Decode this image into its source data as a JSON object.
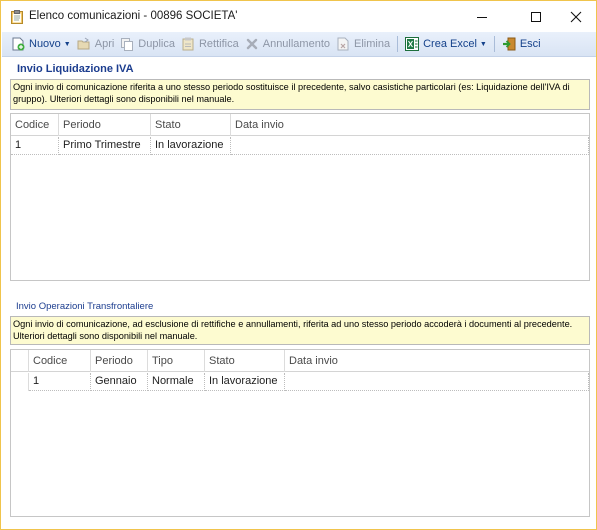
{
  "window": {
    "title": "Elenco comunicazioni - 00896 SOCIETA'",
    "icon": "clipboard-icon",
    "controls": {
      "minimize": "minimize-icon",
      "maximize": "maximize-icon",
      "close": "close-icon"
    }
  },
  "toolbar": {
    "items": [
      {
        "label": "Nuovo",
        "icon": "new-document-icon",
        "enabled": true,
        "dropdown": true
      },
      {
        "label": "Apri",
        "icon": "open-icon",
        "enabled": false
      },
      {
        "label": "Duplica",
        "icon": "duplicate-icon",
        "enabled": false
      },
      {
        "label": "Rettifica",
        "icon": "rectify-icon",
        "enabled": false
      },
      {
        "label": "Annullamento",
        "icon": "cancel-x-icon",
        "enabled": false
      },
      {
        "label": "Elimina",
        "icon": "delete-icon",
        "enabled": false
      },
      {
        "label": "Crea Excel",
        "icon": "excel-icon",
        "enabled": true,
        "dropdown": true
      },
      {
        "label": "Esci",
        "icon": "exit-icon",
        "enabled": true
      }
    ]
  },
  "liquidazione": {
    "title": "Invio Liquidazione IVA",
    "note": "Ogni invio di comunicazione riferita a uno stesso periodo sostituisce il precedente, salvo casistiche particolari (es: Liquidazione dell'IVA di gruppo). Ulteriori dettagli sono disponibili nel manuale.",
    "columns": [
      "Codice",
      "Periodo",
      "Stato",
      "Data invio"
    ],
    "rows": [
      [
        "1",
        "Primo Trimestre",
        "In lavorazione",
        ""
      ]
    ]
  },
  "transfrontaliere": {
    "title": "Invio Operazioni Transfrontaliere",
    "note": "Ogni invio di comunicazione, ad esclusione di rettifiche e annullamenti, riferita ad uno stesso periodo accoderà i documenti al precedente. Ulteriori dettagli sono disponibili nel manuale.",
    "columns": [
      "Codice",
      "Periodo",
      "Tipo",
      "Stato",
      "Data invio"
    ],
    "rows": [
      [
        "1",
        "Gennaio",
        "Normale",
        "In lavorazione",
        ""
      ]
    ]
  }
}
